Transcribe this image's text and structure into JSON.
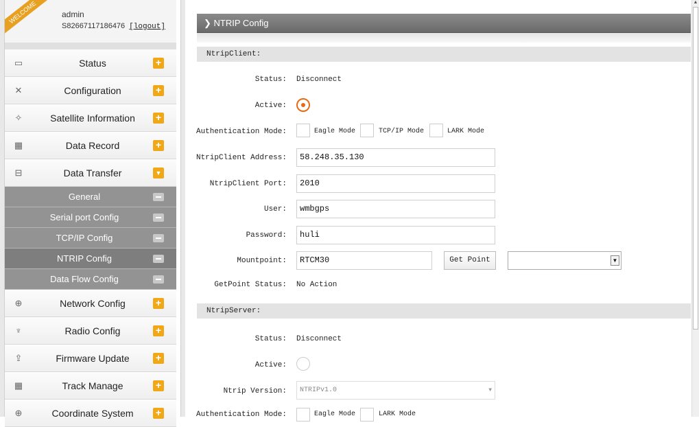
{
  "welcome": {
    "ribbon": "WELCOME",
    "user": "admin",
    "serial": "S82667117186476",
    "logout": "[logout]"
  },
  "nav": {
    "items": [
      {
        "label": "Status",
        "icon": "monitor-icon"
      },
      {
        "label": "Configuration",
        "icon": "tools-icon"
      },
      {
        "label": "Satellite Information",
        "icon": "satellite-icon"
      },
      {
        "label": "Data Record",
        "icon": "calendar-icon"
      },
      {
        "label": "Data Transfer",
        "icon": "network-icon"
      }
    ],
    "sub_items": [
      {
        "label": "General"
      },
      {
        "label": "Serial port Config"
      },
      {
        "label": "TCP/IP Config"
      },
      {
        "label": "NTRIP Config"
      },
      {
        "label": "Data Flow Config"
      }
    ],
    "items_after": [
      {
        "label": "Network Config",
        "icon": "globe-icon"
      },
      {
        "label": "Radio Config",
        "icon": "antenna-icon"
      },
      {
        "label": "Firmware Update",
        "icon": "upload-icon"
      },
      {
        "label": "Track Manage",
        "icon": "calendar-icon"
      },
      {
        "label": "Coordinate System",
        "icon": "globe-icon"
      }
    ]
  },
  "header": {
    "title": "NTRIP Config"
  },
  "client": {
    "section": "NtripClient:",
    "status_label": "Status:",
    "status_value": "Disconnect",
    "active_label": "Active:",
    "auth_label": "Authentication Mode:",
    "auth_options": [
      "Eagle Mode",
      "TCP/IP Mode",
      "LARK Mode"
    ],
    "address_label": "NtripClient Address:",
    "address_value": "58.248.35.130",
    "port_label": "NtripClient Port:",
    "port_value": "2010",
    "user_label": "User:",
    "user_value": "wmbgps",
    "password_label": "Password:",
    "password_value": "huli",
    "mount_label": "Mountpoint:",
    "mount_value": "RTCM30",
    "get_point": "Get Point",
    "getpoint_status_label": "GetPoint Status:",
    "getpoint_status_value": "No Action"
  },
  "server": {
    "section": "NtripServer:",
    "status_label": "Status:",
    "status_value": "Disconnect",
    "active_label": "Active:",
    "version_label": "Ntrip Version:",
    "version_value": "NTRIPv1.0",
    "auth_label": "Authentication Mode:",
    "auth_options": [
      "Eagle Mode",
      "LARK Mode"
    ]
  }
}
